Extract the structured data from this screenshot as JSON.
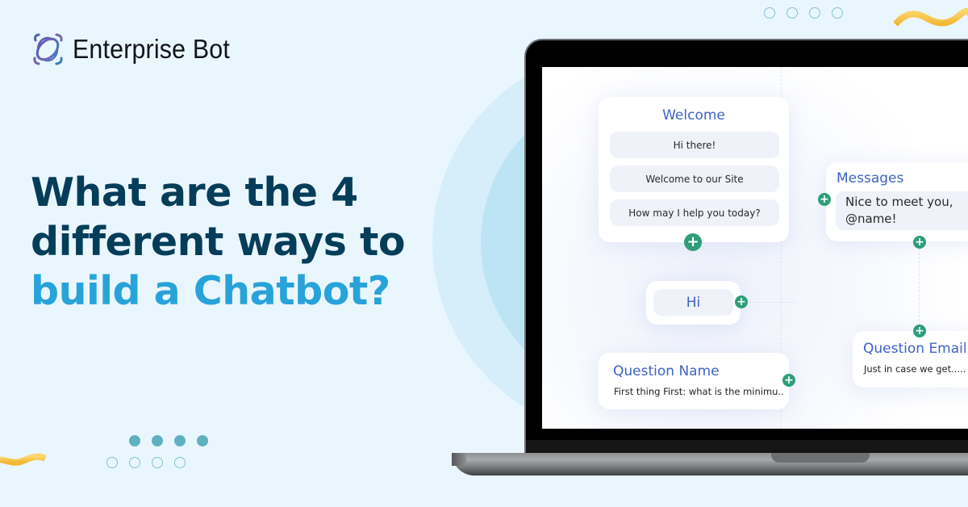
{
  "brand": {
    "name": "Enterprise Bot",
    "logo_icon": "orbit-ring-logo-icon"
  },
  "headline": {
    "line1": "What are the 4",
    "line2": "different ways to",
    "line3": "build a Chatbot?",
    "color_primary": "#033d5a",
    "color_accent": "#28a3da"
  },
  "flow_builder": {
    "welcome_card": {
      "title": "Welcome",
      "messages": [
        "Hi there!",
        "Welcome to our Site",
        "How may I help you today?"
      ]
    },
    "messages_card": {
      "title": "Messages",
      "message": "Nice to meet you, @name!"
    },
    "hi_card": {
      "message": "Hi"
    },
    "question_name_card": {
      "title": "Question Name",
      "text": "First thing First: what is the minimu.."
    },
    "question_email_card": {
      "title": "Question Email",
      "text": "Just in case we get....."
    },
    "add_node_icon": "plus-icon",
    "add_color": "#2e9e7a",
    "title_color": "#3e63c4"
  },
  "decor": {
    "dot_color": "#5fb0c0",
    "squiggle_color": "#f7c94a"
  }
}
